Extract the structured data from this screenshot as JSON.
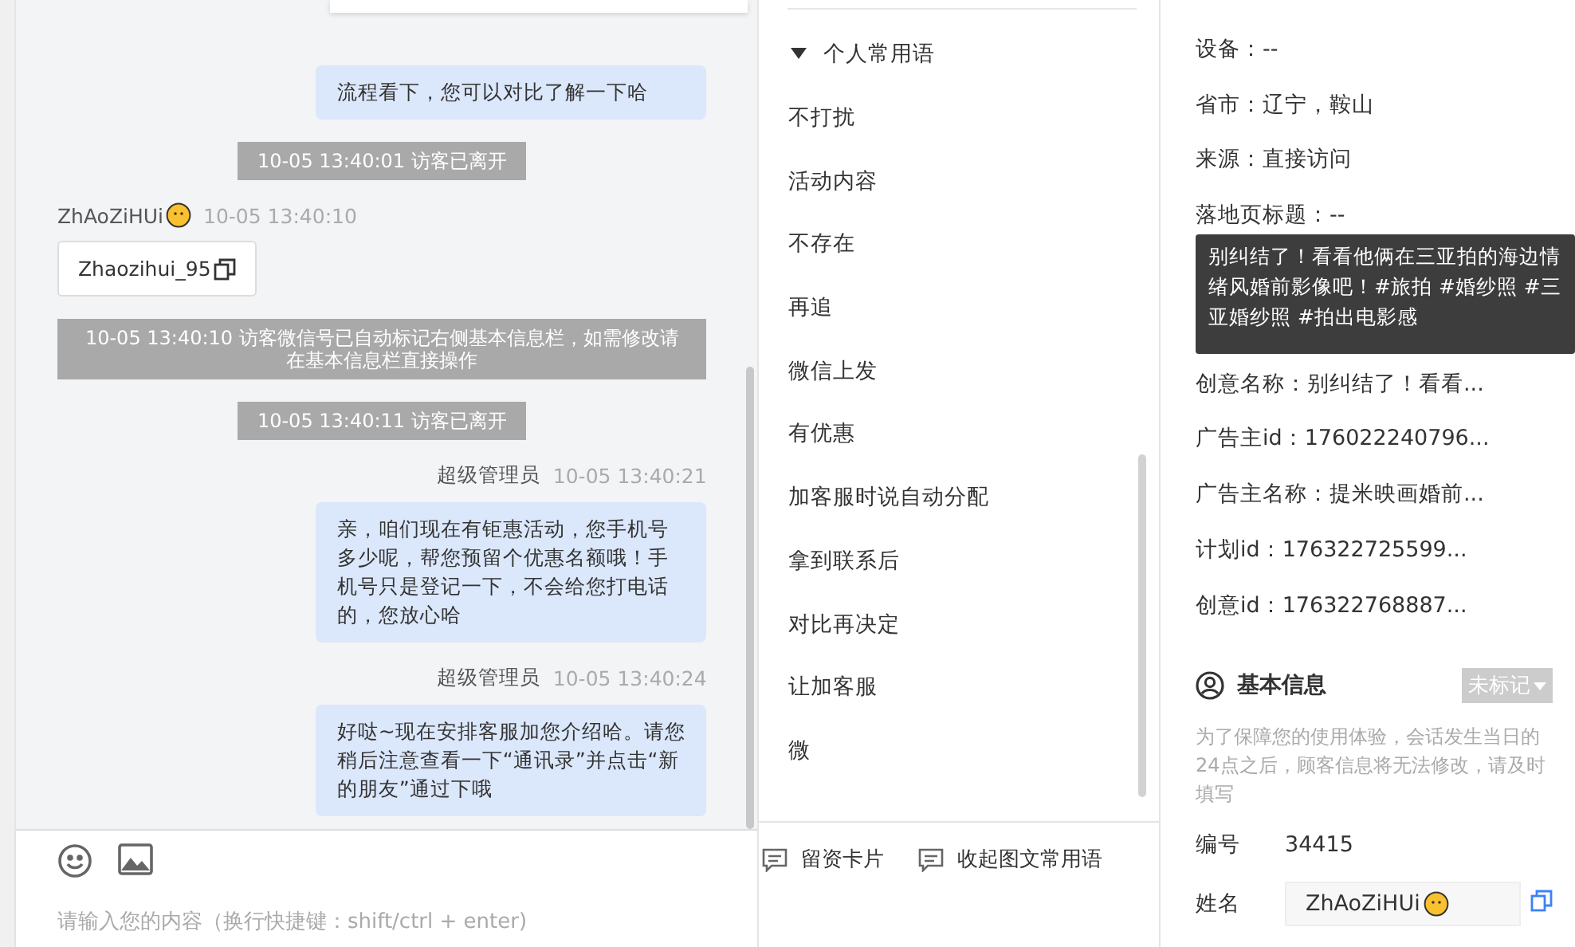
{
  "chat": {
    "messages": [
      {
        "kind": "agent",
        "text": "流程看下，您可以对比了解一下哈"
      },
      {
        "kind": "system",
        "text": "10-05 13:40:01 访客已离开"
      },
      {
        "kind": "visitor",
        "sender": "ZhAoZiHUi",
        "time": "10-05 13:40:10",
        "text": "Zhaozihui_95"
      },
      {
        "kind": "system",
        "text": "10-05 13:40:10 访客微信号已自动标记右侧基本信息栏，如需修改请在基本信息栏直接操作"
      },
      {
        "kind": "system",
        "text": "10-05 13:40:11 访客已离开"
      },
      {
        "kind": "agent",
        "sender": "超级管理员",
        "time": "10-05 13:40:21",
        "text": "亲，咱们现在有钜惠活动，您手机号多少呢，帮您预留个优惠名额哦！手机号只是登记一下，不会给您打电话的，您放心哈"
      },
      {
        "kind": "agent",
        "sender": "超级管理员",
        "time": "10-05 13:40:24",
        "text": "好哒~现在安排客服加您介绍哈。请您稍后注意查看一下“通讯录”并点击“新的朋友”通过下哦"
      }
    ],
    "input": {
      "placeholder": "请输入您的内容（换行快捷键：shift/ctrl + enter)"
    }
  },
  "phrases": {
    "group": {
      "label": "个人常用语",
      "expanded": true
    },
    "items": [
      "不打扰",
      "活动内容",
      "不存在",
      "再追",
      "微信上发",
      "有优惠",
      "加客服时说自动分配",
      "拿到联系后",
      "对比再决定",
      "让加客服",
      "微"
    ],
    "actions": [
      "留资卡片",
      "收起图文常用语"
    ]
  },
  "visit_info": {
    "rows": [
      "设备：--",
      "省市：辽宁，鞍山",
      "来源：直接访问",
      "落地页标题：--"
    ],
    "tooltip": "别纠结了！看看他俩在三亚拍的海边情绪风婚前影像吧！#旅拍 #婚纱照 #三亚婚纱照 #拍出电影感",
    "rows_after": [
      "创意名称：别纠结了！看看...",
      "广告主id：176022240796...",
      "广告主名称：提米映画婚前...",
      "计划id：176322725599...",
      "创意id：176322768887..."
    ]
  },
  "basic_info": {
    "title": "基本信息",
    "tag": "未标记",
    "note": "为了保障您的使用体验，会话发生当日的24点之后，顾客信息将无法修改，请及时填写",
    "fields": [
      {
        "label": "编号",
        "value": "34415",
        "kind": "text"
      },
      {
        "label": "姓名",
        "value": "ZhAoZiHUi",
        "kind": "input"
      }
    ]
  }
}
